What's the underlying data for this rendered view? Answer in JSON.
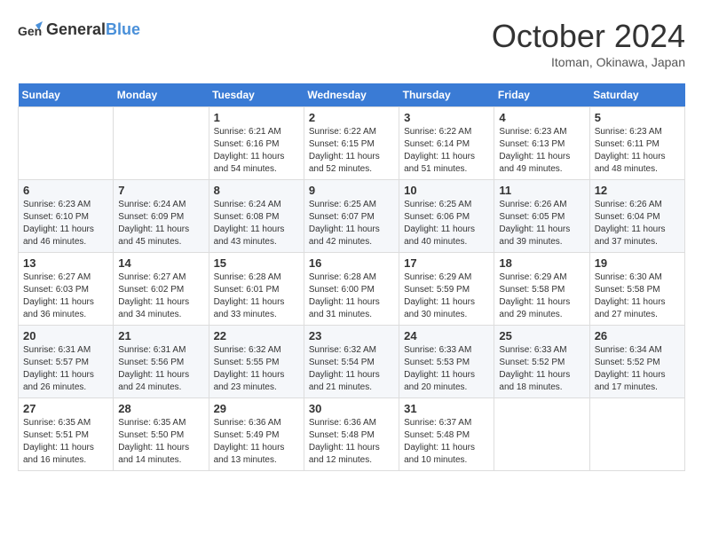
{
  "header": {
    "logo_line1": "General",
    "logo_line2": "Blue",
    "title": "October 2024",
    "location": "Itoman, Okinawa, Japan"
  },
  "weekdays": [
    "Sunday",
    "Monday",
    "Tuesday",
    "Wednesday",
    "Thursday",
    "Friday",
    "Saturday"
  ],
  "weeks": [
    [
      {
        "num": "",
        "info": ""
      },
      {
        "num": "",
        "info": ""
      },
      {
        "num": "1",
        "info": "Sunrise: 6:21 AM\nSunset: 6:16 PM\nDaylight: 11 hours and 54 minutes."
      },
      {
        "num": "2",
        "info": "Sunrise: 6:22 AM\nSunset: 6:15 PM\nDaylight: 11 hours and 52 minutes."
      },
      {
        "num": "3",
        "info": "Sunrise: 6:22 AM\nSunset: 6:14 PM\nDaylight: 11 hours and 51 minutes."
      },
      {
        "num": "4",
        "info": "Sunrise: 6:23 AM\nSunset: 6:13 PM\nDaylight: 11 hours and 49 minutes."
      },
      {
        "num": "5",
        "info": "Sunrise: 6:23 AM\nSunset: 6:11 PM\nDaylight: 11 hours and 48 minutes."
      }
    ],
    [
      {
        "num": "6",
        "info": "Sunrise: 6:23 AM\nSunset: 6:10 PM\nDaylight: 11 hours and 46 minutes."
      },
      {
        "num": "7",
        "info": "Sunrise: 6:24 AM\nSunset: 6:09 PM\nDaylight: 11 hours and 45 minutes."
      },
      {
        "num": "8",
        "info": "Sunrise: 6:24 AM\nSunset: 6:08 PM\nDaylight: 11 hours and 43 minutes."
      },
      {
        "num": "9",
        "info": "Sunrise: 6:25 AM\nSunset: 6:07 PM\nDaylight: 11 hours and 42 minutes."
      },
      {
        "num": "10",
        "info": "Sunrise: 6:25 AM\nSunset: 6:06 PM\nDaylight: 11 hours and 40 minutes."
      },
      {
        "num": "11",
        "info": "Sunrise: 6:26 AM\nSunset: 6:05 PM\nDaylight: 11 hours and 39 minutes."
      },
      {
        "num": "12",
        "info": "Sunrise: 6:26 AM\nSunset: 6:04 PM\nDaylight: 11 hours and 37 minutes."
      }
    ],
    [
      {
        "num": "13",
        "info": "Sunrise: 6:27 AM\nSunset: 6:03 PM\nDaylight: 11 hours and 36 minutes."
      },
      {
        "num": "14",
        "info": "Sunrise: 6:27 AM\nSunset: 6:02 PM\nDaylight: 11 hours and 34 minutes."
      },
      {
        "num": "15",
        "info": "Sunrise: 6:28 AM\nSunset: 6:01 PM\nDaylight: 11 hours and 33 minutes."
      },
      {
        "num": "16",
        "info": "Sunrise: 6:28 AM\nSunset: 6:00 PM\nDaylight: 11 hours and 31 minutes."
      },
      {
        "num": "17",
        "info": "Sunrise: 6:29 AM\nSunset: 5:59 PM\nDaylight: 11 hours and 30 minutes."
      },
      {
        "num": "18",
        "info": "Sunrise: 6:29 AM\nSunset: 5:58 PM\nDaylight: 11 hours and 29 minutes."
      },
      {
        "num": "19",
        "info": "Sunrise: 6:30 AM\nSunset: 5:58 PM\nDaylight: 11 hours and 27 minutes."
      }
    ],
    [
      {
        "num": "20",
        "info": "Sunrise: 6:31 AM\nSunset: 5:57 PM\nDaylight: 11 hours and 26 minutes."
      },
      {
        "num": "21",
        "info": "Sunrise: 6:31 AM\nSunset: 5:56 PM\nDaylight: 11 hours and 24 minutes."
      },
      {
        "num": "22",
        "info": "Sunrise: 6:32 AM\nSunset: 5:55 PM\nDaylight: 11 hours and 23 minutes."
      },
      {
        "num": "23",
        "info": "Sunrise: 6:32 AM\nSunset: 5:54 PM\nDaylight: 11 hours and 21 minutes."
      },
      {
        "num": "24",
        "info": "Sunrise: 6:33 AM\nSunset: 5:53 PM\nDaylight: 11 hours and 20 minutes."
      },
      {
        "num": "25",
        "info": "Sunrise: 6:33 AM\nSunset: 5:52 PM\nDaylight: 11 hours and 18 minutes."
      },
      {
        "num": "26",
        "info": "Sunrise: 6:34 AM\nSunset: 5:52 PM\nDaylight: 11 hours and 17 minutes."
      }
    ],
    [
      {
        "num": "27",
        "info": "Sunrise: 6:35 AM\nSunset: 5:51 PM\nDaylight: 11 hours and 16 minutes."
      },
      {
        "num": "28",
        "info": "Sunrise: 6:35 AM\nSunset: 5:50 PM\nDaylight: 11 hours and 14 minutes."
      },
      {
        "num": "29",
        "info": "Sunrise: 6:36 AM\nSunset: 5:49 PM\nDaylight: 11 hours and 13 minutes."
      },
      {
        "num": "30",
        "info": "Sunrise: 6:36 AM\nSunset: 5:48 PM\nDaylight: 11 hours and 12 minutes."
      },
      {
        "num": "31",
        "info": "Sunrise: 6:37 AM\nSunset: 5:48 PM\nDaylight: 11 hours and 10 minutes."
      },
      {
        "num": "",
        "info": ""
      },
      {
        "num": "",
        "info": ""
      }
    ]
  ]
}
